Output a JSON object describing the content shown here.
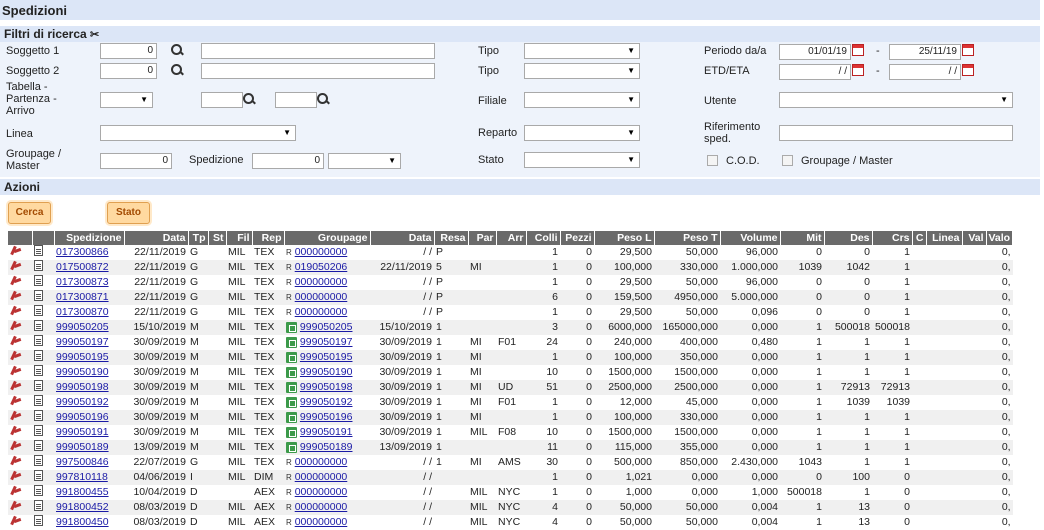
{
  "title": "Spedizioni",
  "filters": {
    "header": "Filtri di ricerca",
    "soggetto1_label": "Soggetto 1",
    "soggetto1_value": "0",
    "soggetto2_label": "Soggetto 2",
    "soggetto2_value": "0",
    "tabella_label": "Tabella - Partenza - Arrivo",
    "linea_label": "Linea",
    "groupage_label": "Groupage / Master",
    "groupage_value": "0",
    "spedizione_label": "Spedizione",
    "spedizione_value": "0",
    "tipo_label": "Tipo",
    "tipo2_label": "Tipo",
    "filiale_label": "Filiale",
    "reparto_label": "Reparto",
    "stato_label": "Stato",
    "periodo_label": "Periodo da/a",
    "periodo_from": "01/01/19",
    "periodo_to": "25/11/19",
    "etd_label": "ETD/ETA",
    "etd_from": "/ /",
    "etd_to": "/ /",
    "dash": "-",
    "utente_label": "Utente",
    "rif_label": "Riferimento sped.",
    "cod_label": "C.O.D.",
    "gm_label": "Groupage / Master"
  },
  "actions": {
    "header": "Azioni",
    "cerca": "Cerca",
    "stato": "Stato"
  },
  "table": {
    "columns": [
      "Spedizione",
      "Data",
      "Tp",
      "St",
      "Fil",
      "Rep",
      "Groupage",
      "Data",
      "Resa",
      "Par",
      "Arr",
      "Colli",
      "Pezzi",
      "Peso L",
      "Peso T",
      "Volume",
      "Mit",
      "Des",
      "Crs",
      "C",
      "Linea",
      "Val",
      "Valo"
    ],
    "rows": [
      {
        "sped": "017300866",
        "data": "22/11/2019",
        "tp": "G",
        "fil": "MIL",
        "rep": "TEX",
        "xl": false,
        "grp": "000000000",
        "gdata": "/ /",
        "resa": "P",
        "par": "",
        "arr": "",
        "colli": "1",
        "pezzi": "0",
        "pl": "29,500",
        "pt": "50,000",
        "vol": "96,000",
        "mit": "0",
        "des": "0",
        "crs": "1",
        "valo": "0,"
      },
      {
        "sped": "017500872",
        "data": "22/11/2019",
        "tp": "G",
        "fil": "MIL",
        "rep": "TEX",
        "xl": false,
        "grp": "019050206",
        "gdata": "22/11/2019",
        "resa": "5",
        "par": "MI",
        "arr": "",
        "colli": "1",
        "pezzi": "0",
        "pl": "100,000",
        "pt": "330,000",
        "vol": "1.000,000",
        "mit": "1039",
        "des": "1042",
        "crs": "1",
        "valo": "0,"
      },
      {
        "sped": "017300873",
        "data": "22/11/2019",
        "tp": "G",
        "fil": "MIL",
        "rep": "TEX",
        "xl": false,
        "grp": "000000000",
        "gdata": "/ /",
        "resa": "P",
        "par": "",
        "arr": "",
        "colli": "1",
        "pezzi": "0",
        "pl": "29,500",
        "pt": "50,000",
        "vol": "96,000",
        "mit": "0",
        "des": "0",
        "crs": "1",
        "valo": "0,"
      },
      {
        "sped": "017300871",
        "data": "22/11/2019",
        "tp": "G",
        "fil": "MIL",
        "rep": "TEX",
        "xl": false,
        "grp": "000000000",
        "gdata": "/ /",
        "resa": "P",
        "par": "",
        "arr": "",
        "colli": "6",
        "pezzi": "0",
        "pl": "159,500",
        "pt": "4950,000",
        "vol": "5.000,000",
        "mit": "0",
        "des": "0",
        "crs": "1",
        "valo": "0,"
      },
      {
        "sped": "017300870",
        "data": "22/11/2019",
        "tp": "G",
        "fil": "MIL",
        "rep": "TEX",
        "xl": false,
        "grp": "000000000",
        "gdata": "/ /",
        "resa": "P",
        "par": "",
        "arr": "",
        "colli": "1",
        "pezzi": "0",
        "pl": "29,500",
        "pt": "50,000",
        "vol": "0,096",
        "mit": "0",
        "des": "0",
        "crs": "1",
        "valo": "0,"
      },
      {
        "sped": "999050205",
        "data": "15/10/2019",
        "tp": "M",
        "fil": "MIL",
        "rep": "TEX",
        "xl": true,
        "grp": "999050205",
        "gdata": "15/10/2019",
        "resa": "1",
        "par": "",
        "arr": "",
        "colli": "3",
        "pezzi": "0",
        "pl": "6000,000",
        "pt": "165000,000",
        "vol": "0,000",
        "mit": "1",
        "des": "500018",
        "crs": "500018",
        "valo": "0,"
      },
      {
        "sped": "999050197",
        "data": "30/09/2019",
        "tp": "M",
        "fil": "MIL",
        "rep": "TEX",
        "xl": true,
        "grp": "999050197",
        "gdata": "30/09/2019",
        "resa": "1",
        "par": "MI",
        "arr": "F01",
        "colli": "24",
        "pezzi": "0",
        "pl": "240,000",
        "pt": "400,000",
        "vol": "0,480",
        "mit": "1",
        "des": "1",
        "crs": "1",
        "valo": "0,"
      },
      {
        "sped": "999050195",
        "data": "30/09/2019",
        "tp": "M",
        "fil": "MIL",
        "rep": "TEX",
        "xl": true,
        "grp": "999050195",
        "gdata": "30/09/2019",
        "resa": "1",
        "par": "MI",
        "arr": "",
        "colli": "1",
        "pezzi": "0",
        "pl": "100,000",
        "pt": "350,000",
        "vol": "0,000",
        "mit": "1",
        "des": "1",
        "crs": "1",
        "valo": "0,"
      },
      {
        "sped": "999050190",
        "data": "30/09/2019",
        "tp": "M",
        "fil": "MIL",
        "rep": "TEX",
        "xl": true,
        "grp": "999050190",
        "gdata": "30/09/2019",
        "resa": "1",
        "par": "MI",
        "arr": "",
        "colli": "10",
        "pezzi": "0",
        "pl": "1500,000",
        "pt": "1500,000",
        "vol": "0,000",
        "mit": "1",
        "des": "1",
        "crs": "1",
        "valo": "0,"
      },
      {
        "sped": "999050198",
        "data": "30/09/2019",
        "tp": "M",
        "fil": "MIL",
        "rep": "TEX",
        "xl": true,
        "grp": "999050198",
        "gdata": "30/09/2019",
        "resa": "1",
        "par": "MI",
        "arr": "UD",
        "colli": "51",
        "pezzi": "0",
        "pl": "2500,000",
        "pt": "2500,000",
        "vol": "0,000",
        "mit": "1",
        "des": "72913",
        "crs": "72913",
        "valo": "0,"
      },
      {
        "sped": "999050192",
        "data": "30/09/2019",
        "tp": "M",
        "fil": "MIL",
        "rep": "TEX",
        "xl": true,
        "grp": "999050192",
        "gdata": "30/09/2019",
        "resa": "1",
        "par": "MI",
        "arr": "F01",
        "colli": "1",
        "pezzi": "0",
        "pl": "12,000",
        "pt": "45,000",
        "vol": "0,000",
        "mit": "1",
        "des": "1039",
        "crs": "1039",
        "valo": "0,"
      },
      {
        "sped": "999050196",
        "data": "30/09/2019",
        "tp": "M",
        "fil": "MIL",
        "rep": "TEX",
        "xl": true,
        "grp": "999050196",
        "gdata": "30/09/2019",
        "resa": "1",
        "par": "MI",
        "arr": "",
        "colli": "1",
        "pezzi": "0",
        "pl": "100,000",
        "pt": "330,000",
        "vol": "0,000",
        "mit": "1",
        "des": "1",
        "crs": "1",
        "valo": "0,"
      },
      {
        "sped": "999050191",
        "data": "30/09/2019",
        "tp": "M",
        "fil": "MIL",
        "rep": "TEX",
        "xl": true,
        "grp": "999050191",
        "gdata": "30/09/2019",
        "resa": "1",
        "par": "MIL",
        "arr": "F08",
        "colli": "10",
        "pezzi": "0",
        "pl": "1500,000",
        "pt": "1500,000",
        "vol": "0,000",
        "mit": "1",
        "des": "1",
        "crs": "1",
        "valo": "0,"
      },
      {
        "sped": "999050189",
        "data": "13/09/2019",
        "tp": "M",
        "fil": "MIL",
        "rep": "TEX",
        "xl": true,
        "grp": "999050189",
        "gdata": "13/09/2019",
        "resa": "1",
        "par": "",
        "arr": "",
        "colli": "11",
        "pezzi": "0",
        "pl": "115,000",
        "pt": "355,000",
        "vol": "0,000",
        "mit": "1",
        "des": "1",
        "crs": "1",
        "valo": "0,"
      },
      {
        "sped": "997500846",
        "data": "22/07/2019",
        "tp": "G",
        "fil": "MIL",
        "rep": "TEX",
        "xl": false,
        "grp": "000000000",
        "gdata": "/ /",
        "resa": "1",
        "par": "MI",
        "arr": "AMS",
        "colli": "30",
        "pezzi": "0",
        "pl": "500,000",
        "pt": "850,000",
        "vol": "2.430,000",
        "mit": "1043",
        "des": "1",
        "crs": "1",
        "valo": "0,"
      },
      {
        "sped": "997810118",
        "data": "04/06/2019",
        "tp": "I",
        "fil": "MIL",
        "rep": "DIM",
        "xl": false,
        "grp": "000000000",
        "gdata": "/ /",
        "resa": "",
        "par": "",
        "arr": "",
        "colli": "1",
        "pezzi": "0",
        "pl": "1,021",
        "pt": "0,000",
        "vol": "0,000",
        "mit": "0",
        "des": "100",
        "crs": "0",
        "valo": "0,"
      },
      {
        "sped": "991800455",
        "data": "10/04/2019",
        "tp": "D",
        "fil": "",
        "rep": "AEX",
        "xl": false,
        "grp": "000000000",
        "gdata": "/ /",
        "resa": "",
        "par": "MIL",
        "arr": "NYC",
        "colli": "1",
        "pezzi": "0",
        "pl": "1,000",
        "pt": "0,000",
        "vol": "1,000",
        "mit": "500018",
        "des": "1",
        "crs": "0",
        "valo": "0,"
      },
      {
        "sped": "991800452",
        "data": "08/03/2019",
        "tp": "D",
        "fil": "MIL",
        "rep": "AEX",
        "xl": false,
        "grp": "000000000",
        "gdata": "/ /",
        "resa": "",
        "par": "MIL",
        "arr": "NYC",
        "colli": "4",
        "pezzi": "0",
        "pl": "50,000",
        "pt": "50,000",
        "vol": "0,004",
        "mit": "1",
        "des": "13",
        "crs": "0",
        "valo": "0,"
      },
      {
        "sped": "991800450",
        "data": "08/03/2019",
        "tp": "D",
        "fil": "MIL",
        "rep": "AEX",
        "xl": false,
        "grp": "000000000",
        "gdata": "/ /",
        "resa": "",
        "par": "MIL",
        "arr": "NYC",
        "colli": "4",
        "pezzi": "0",
        "pl": "50,000",
        "pt": "50,000",
        "vol": "0,004",
        "mit": "1",
        "des": "13",
        "crs": "0",
        "valo": "0,"
      }
    ]
  }
}
